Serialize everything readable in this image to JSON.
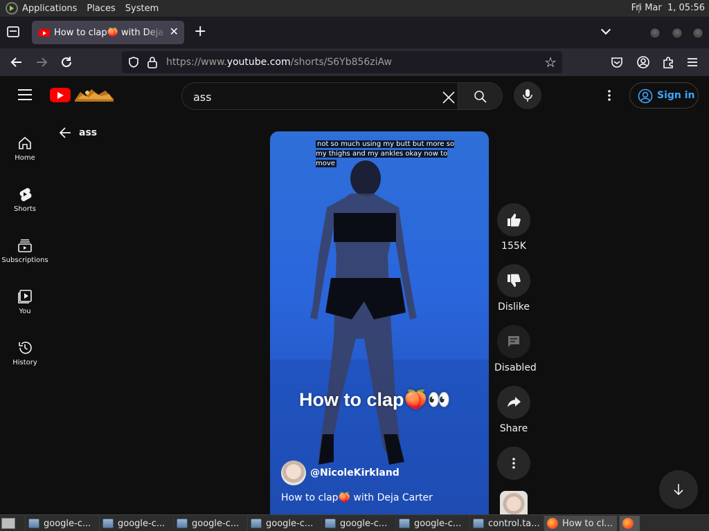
{
  "system_panel": {
    "menus": [
      "Applications",
      "Places",
      "System"
    ],
    "clock": "Fri Mar  1, 05:56"
  },
  "browser": {
    "tab_title": "How to clap🍑 with Deja Carter",
    "url_prefix": "https://www.",
    "url_host": "youtube.com",
    "url_path": "/shorts/S6Yb856ziAw"
  },
  "youtube": {
    "search_value": "ass",
    "sign_in": "Sign in",
    "back_label": "ass",
    "guide": [
      {
        "label": "Home",
        "icon": "home-icon"
      },
      {
        "label": "Shorts",
        "icon": "shorts-icon"
      },
      {
        "label": "Subscriptions",
        "icon": "subscriptions-icon"
      },
      {
        "label": "You",
        "icon": "you-icon"
      },
      {
        "label": "History",
        "icon": "history-icon"
      }
    ],
    "short": {
      "caption": "not so much using my butt but more so my thighs and my ankles okay now to move",
      "overlay_title": "How to clap🍑👀",
      "channel": "@NicoleKirkland",
      "title": "How to clap🍑 with Deja Carter"
    },
    "actions": {
      "like_count": "155K",
      "dislike": "Dislike",
      "comments": "Disabled",
      "share": "Share"
    }
  },
  "taskbar": {
    "tasks": [
      "google-c...",
      "google-c...",
      "google-c...",
      "google-c...",
      "google-c...",
      "google-c...",
      "control.ta...",
      "How to cl..."
    ]
  },
  "colors": {
    "yt_red": "#ff0000",
    "sign_in_blue": "#3ea6ff",
    "background": "#0f0f0f"
  }
}
